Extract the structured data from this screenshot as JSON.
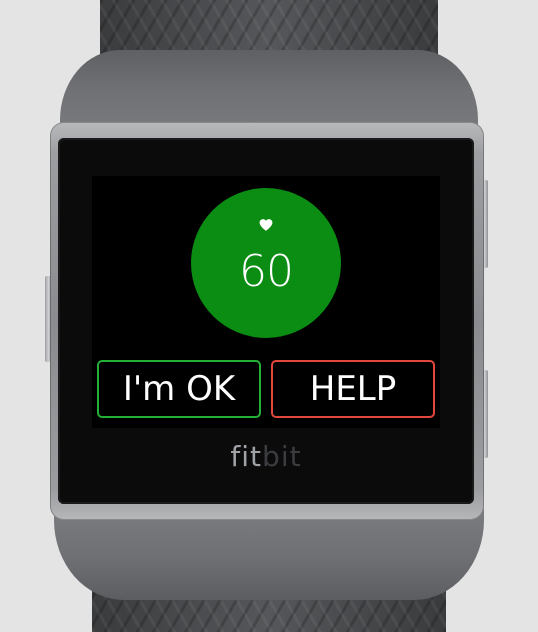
{
  "device": {
    "brand_part1": "fit",
    "brand_part2": "bit"
  },
  "screen": {
    "heart_rate": "60",
    "heart_icon": "heart-icon",
    "ok_button_label": "I'm OK",
    "help_button_label": "HELP"
  },
  "colors": {
    "circle": "#0b8c12",
    "ok_border": "#22b036",
    "help_border": "#e2473b"
  }
}
